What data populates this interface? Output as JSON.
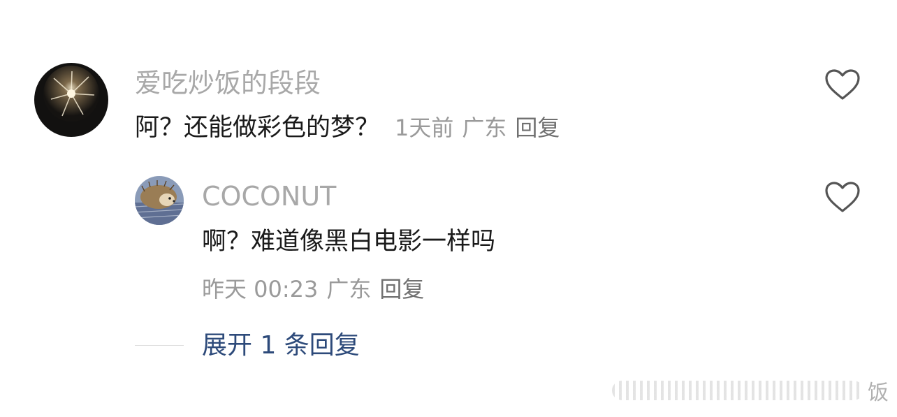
{
  "comments": [
    {
      "username": "爱吃炒饭的段段",
      "text": "阿？还能做彩色的梦？",
      "time": "1天前",
      "location": "广东",
      "reply_label": "回复",
      "avatar_icon": "fireworks-avatar-icon"
    }
  ],
  "replies": [
    {
      "username": "COCONUT",
      "text": "啊？难道像黑白电影一样吗",
      "time": "昨天 00:23",
      "location": "广东",
      "reply_label": "回复",
      "avatar_icon": "hedgehog-avatar-icon"
    }
  ],
  "expand_label": "展开 1 条回复",
  "watermark_text": "饭",
  "colors": {
    "username": "#a8a8a8",
    "meta": "#9a9a9a",
    "expand": "#2d4a7a",
    "heart_stroke": "#555555"
  },
  "icons": {
    "like": "heart-outline-icon"
  }
}
